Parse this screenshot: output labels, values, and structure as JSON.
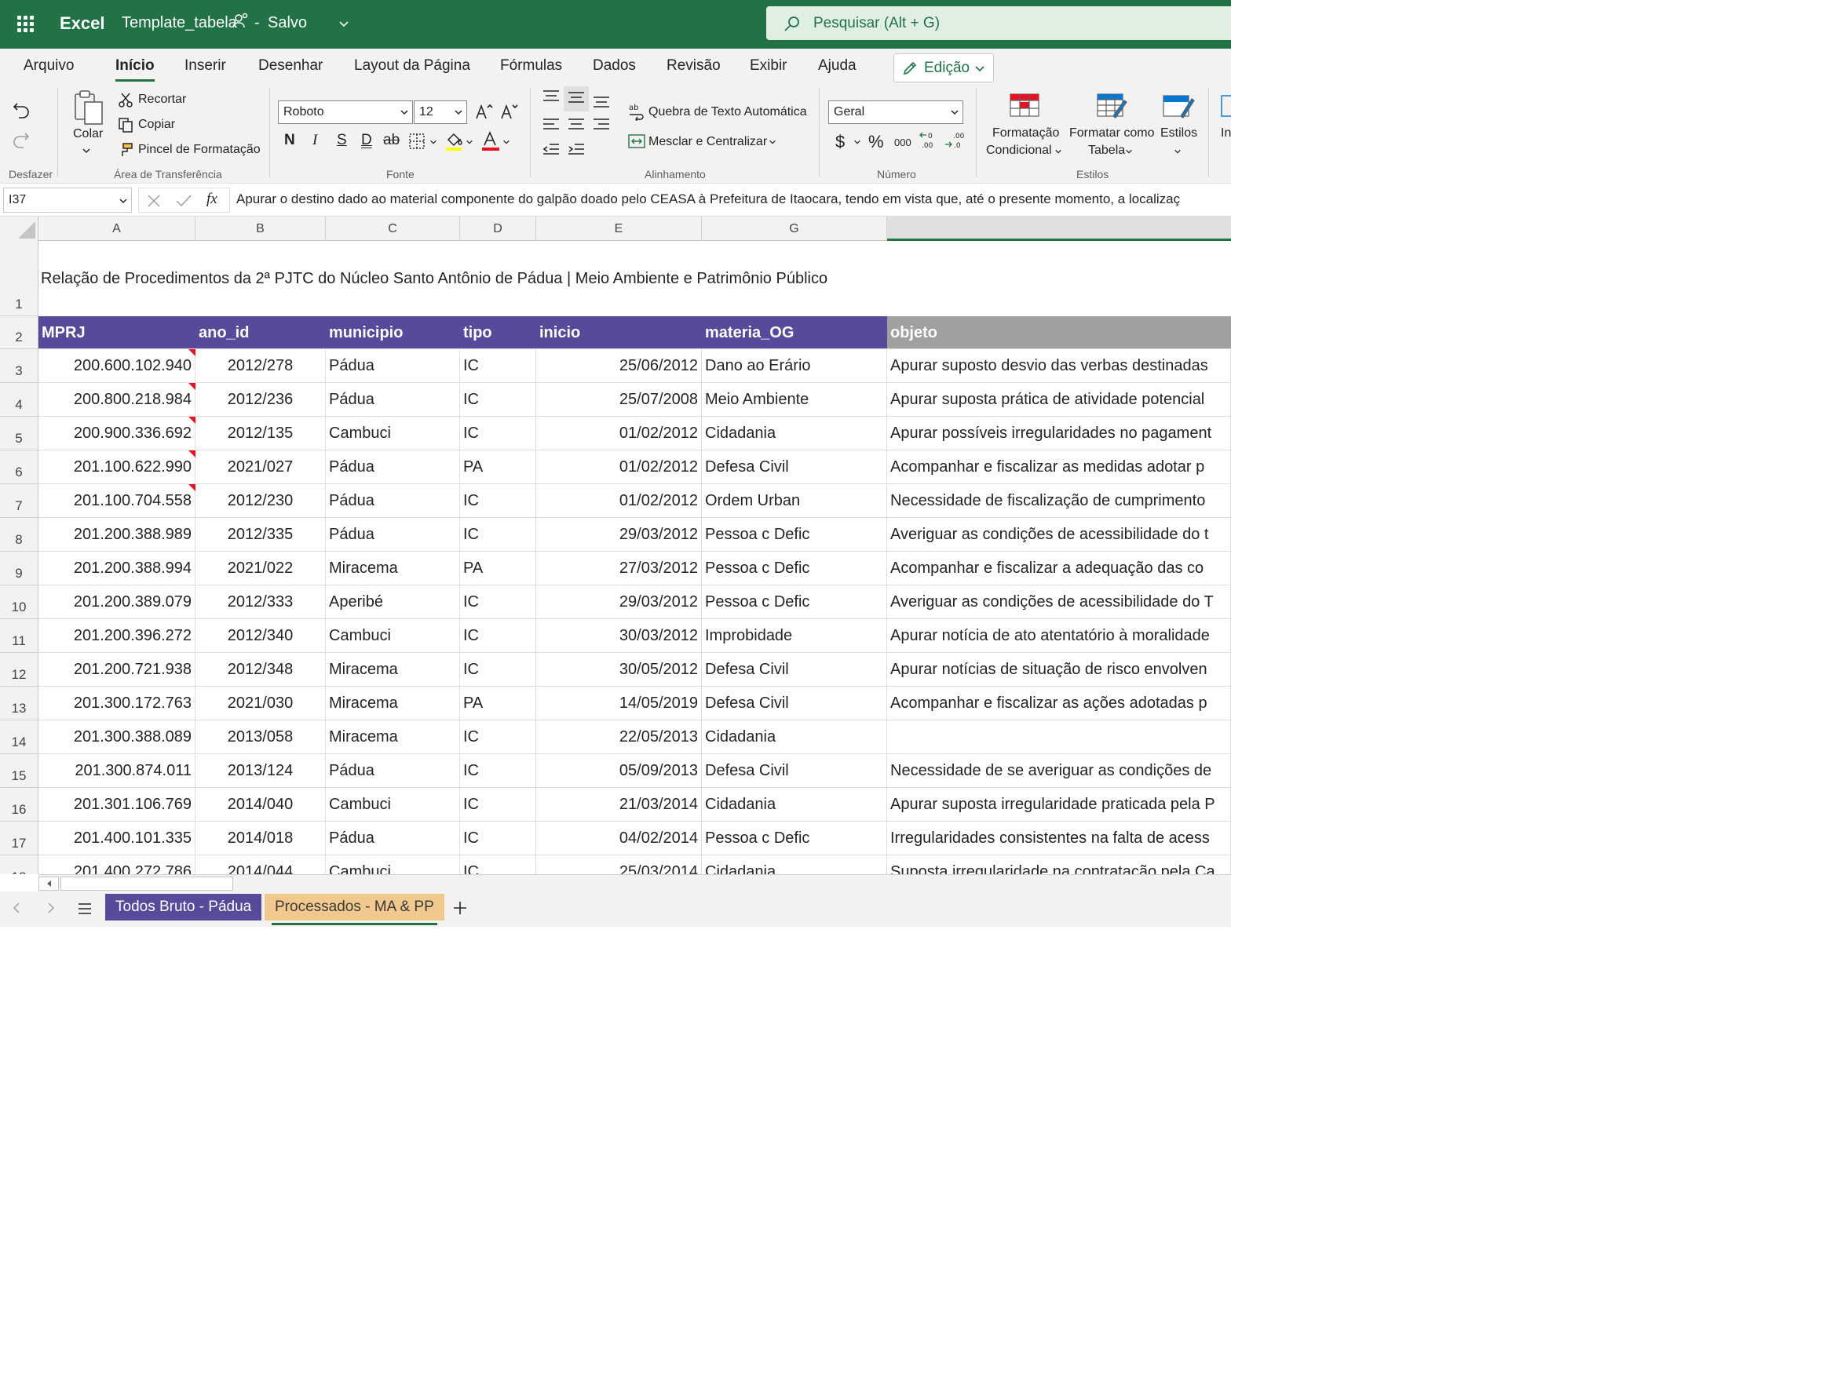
{
  "titlebar": {
    "app_name": "Excel",
    "doc_name": "Template_tabela",
    "separator": "-",
    "status": "Salvo",
    "search_placeholder": "Pesquisar (Alt + G)",
    "brand_color": "#217346"
  },
  "ribbon_tabs": [
    {
      "label": "Arquivo",
      "active": false
    },
    {
      "label": "Início",
      "active": true
    },
    {
      "label": "Inserir",
      "active": false
    },
    {
      "label": "Desenhar",
      "active": false
    },
    {
      "label": "Layout da Página",
      "active": false
    },
    {
      "label": "Fórmulas",
      "active": false
    },
    {
      "label": "Dados",
      "active": false
    },
    {
      "label": "Revisão",
      "active": false
    },
    {
      "label": "Exibir",
      "active": false
    },
    {
      "label": "Ajuda",
      "active": false
    }
  ],
  "edit_mode": "Edição",
  "ribbon": {
    "undo_group": "Desfazer",
    "clipboard": {
      "paste": "Colar",
      "cut": "Recortar",
      "copy": "Copiar",
      "format_painter": "Pincel de Formatação",
      "group": "Área de Transferência"
    },
    "font": {
      "font_name": "Roboto",
      "font_size": "12",
      "bold": "N",
      "italic": "I",
      "underline": "S",
      "double_underline": "D",
      "strike": "ab",
      "group": "Fonte"
    },
    "alignment": {
      "wrap": "Quebra de Texto Automática",
      "merge": "Mesclar e Centralizar",
      "group": "Alinhamento"
    },
    "number": {
      "format": "Geral",
      "currency": "$",
      "percent": "%",
      "thousands": "000",
      "group": "Número"
    },
    "styles": {
      "conditional_line1": "Formatação",
      "conditional_line2": "Condicional",
      "table_line1": "Formatar como",
      "table_line2": "Tabela",
      "styles": "Estilos",
      "group": "Estilos",
      "insert_partial": "In"
    }
  },
  "formula_bar": {
    "cell_ref": "I37",
    "fx": "fx",
    "content": "Apurar o destino dado ao material componente do galpão doado pelo CEASA à Prefeitura de Itaocara, tendo em vista que, até o presente momento, a localizaç"
  },
  "columns": [
    "A",
    "B",
    "C",
    "D",
    "E",
    "G"
  ],
  "sheet_title": "Relação de Procedimentos da 2ª PJTC do Núcleo Santo Antônio de Pádua |  Meio Ambiente e Patrimônio Público",
  "table_header": [
    "MPRJ",
    "ano_id",
    "municipio",
    "tipo",
    "inicio",
    "materia_OG",
    "objeto"
  ],
  "header_colors": {
    "main": "#574a9b",
    "objeto": "#a0a0a0"
  },
  "rows": [
    {
      "n": "3",
      "mprj": "200.600.102.940",
      "ano": "2012/278",
      "mun": "Pádua",
      "tipo": "IC",
      "inicio": "25/06/2012",
      "materia": "Dano ao Erário",
      "objeto": "Apurar suposto desvio das verbas destinadas",
      "comment": true
    },
    {
      "n": "4",
      "mprj": "200.800.218.984",
      "ano": "2012/236",
      "mun": "Pádua",
      "tipo": "IC",
      "inicio": "25/07/2008",
      "materia": "Meio Ambiente",
      "objeto": "Apurar suposta prática de atividade potencial",
      "comment": true
    },
    {
      "n": "5",
      "mprj": "200.900.336.692",
      "ano": "2012/135",
      "mun": "Cambuci",
      "tipo": "IC",
      "inicio": "01/02/2012",
      "materia": "Cidadania",
      "objeto": "Apurar possíveis irregularidades no pagament",
      "comment": true
    },
    {
      "n": "6",
      "mprj": "201.100.622.990",
      "ano": "2021/027",
      "mun": "Pádua",
      "tipo": "PA",
      "inicio": "01/02/2012",
      "materia": "Defesa Civil",
      "objeto": "Acompanhar e fiscalizar as medidas adotar p",
      "comment": true
    },
    {
      "n": "7",
      "mprj": "201.100.704.558",
      "ano": "2012/230",
      "mun": "Pádua",
      "tipo": "IC",
      "inicio": "01/02/2012",
      "materia": "Ordem Urban",
      "objeto": "Necessidade de fiscalização de cumprimento",
      "comment": true
    },
    {
      "n": "8",
      "mprj": "201.200.388.989",
      "ano": "2012/335",
      "mun": "Pádua",
      "tipo": "IC",
      "inicio": "29/03/2012",
      "materia": "Pessoa c Defic",
      "objeto": "Averiguar as condições de acessibilidade do t",
      "comment": false
    },
    {
      "n": "9",
      "mprj": "201.200.388.994",
      "ano": "2021/022",
      "mun": "Miracema",
      "tipo": "PA",
      "inicio": "27/03/2012",
      "materia": "Pessoa c Defic",
      "objeto": "Acompanhar e fiscalizar a adequação das co",
      "comment": false
    },
    {
      "n": "10",
      "mprj": "201.200.389.079",
      "ano": "2012/333",
      "mun": "Aperibé",
      "tipo": "IC",
      "inicio": "29/03/2012",
      "materia": "Pessoa c Defic",
      "objeto": "Averiguar as condições de acessibilidade do T",
      "comment": false
    },
    {
      "n": "11",
      "mprj": "201.200.396.272",
      "ano": "2012/340",
      "mun": "Cambuci",
      "tipo": "IC",
      "inicio": "30/03/2012",
      "materia": "Improbidade",
      "objeto": "Apurar notícia de ato atentatório à moralidade",
      "comment": false
    },
    {
      "n": "12",
      "mprj": "201.200.721.938",
      "ano": "2012/348",
      "mun": "Miracema",
      "tipo": "IC",
      "inicio": "30/05/2012",
      "materia": "Defesa Civil",
      "objeto": "Apurar notícias de situação de risco envolven",
      "comment": false
    },
    {
      "n": "13",
      "mprj": "201.300.172.763",
      "ano": "2021/030",
      "mun": "Miracema",
      "tipo": "PA",
      "inicio": "14/05/2019",
      "materia": "Defesa Civil",
      "objeto": "Acompanhar e fiscalizar as ações adotadas p",
      "comment": false
    },
    {
      "n": "14",
      "mprj": "201.300.388.089",
      "ano": "2013/058",
      "mun": "Miracema",
      "tipo": "IC",
      "inicio": "22/05/2013",
      "materia": "Cidadania",
      "objeto": "",
      "comment": false
    },
    {
      "n": "15",
      "mprj": "201.300.874.011",
      "ano": "2013/124",
      "mun": "Pádua",
      "tipo": "IC",
      "inicio": "05/09/2013",
      "materia": "Defesa Civil",
      "objeto": "Necessidade de se averiguar as condições de",
      "comment": false
    },
    {
      "n": "16",
      "mprj": "201.301.106.769",
      "ano": "2014/040",
      "mun": "Cambuci",
      "tipo": "IC",
      "inicio": "21/03/2014",
      "materia": "Cidadania",
      "objeto": "Apurar suposta irregularidade praticada pela P",
      "comment": false
    },
    {
      "n": "17",
      "mprj": "201.400.101.335",
      "ano": "2014/018",
      "mun": "Pádua",
      "tipo": "IC",
      "inicio": "04/02/2014",
      "materia": "Pessoa c Defic",
      "objeto": "Irregularidades consistentes na falta de acess",
      "comment": false
    },
    {
      "n": "18",
      "mprj": "201.400.272.786",
      "ano": "2014/044",
      "mun": "Cambuci",
      "tipo": "IC",
      "inicio": "25/03/2014",
      "materia": "Cidadania",
      "objeto": "Suposta irregularidade na contratação pela Ca",
      "comment": false
    }
  ],
  "sheet_tabs": [
    {
      "label": "Todos Bruto - Pádua",
      "color": "#574a9b"
    },
    {
      "label": "Processados - MA & PP",
      "color": "#f1c98e",
      "active": true
    }
  ]
}
